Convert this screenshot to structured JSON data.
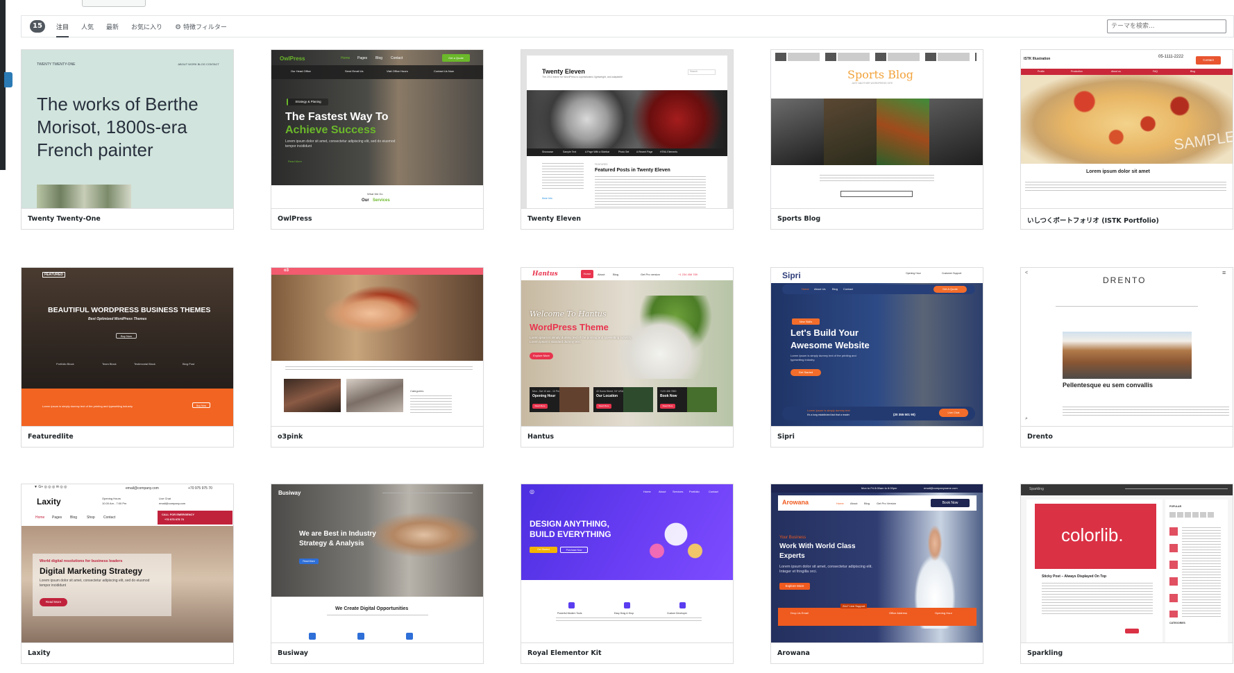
{
  "filter": {
    "count": "15",
    "tabs": [
      "注目",
      "人気",
      "最新",
      "お気に入り"
    ],
    "feature_filter": "特徴フィルター",
    "search_placeholder": "テーマを検索..."
  },
  "themes": [
    {
      "name": "Twenty Twenty-One",
      "preview": {
        "site": "TWENTY TWENTY-ONE",
        "menu": "ABOUT   WORK   BLOG   CONTACT",
        "headline": "The works of Berthe Morisot, 1800s-era French painter"
      }
    },
    {
      "name": "OwlPress",
      "preview": {
        "logo": "OwlPress",
        "nav": [
          "Home",
          "Pages",
          "Blog",
          "Contact"
        ],
        "quote": "Get a Quote",
        "info": [
          "Our Head Office",
          "Send Email Us",
          "Visit Office Hours",
          "Contact Us Now"
        ],
        "tag": "Strategy & Planing",
        "h1": "The Fastest Way To",
        "h2": "Achieve Success",
        "body": "Lorem ipsum dolor sit amet, consectetur adipiscing elit, sed do eiusmod tempor incididunt",
        "more": "Read More",
        "what": "What We Do",
        "our": "Our",
        "services": "Services"
      }
    },
    {
      "name": "Twenty Eleven",
      "preview": {
        "title": "Twenty Eleven",
        "subtitle": "The 2011 theme for WordPress is sophisticated, lightweight, and adaptable",
        "search": "Search",
        "nav": [
          "Showcase",
          "Sample Text",
          "A Page With a Sidebar",
          "Photo Set",
          "A Recent Page",
          "HTML Elements"
        ],
        "featured": "FEATURED",
        "posts_title": "Featured Posts in Twenty Eleven",
        "more": "More Info"
      }
    },
    {
      "name": "Sports Blog",
      "preview": {
        "logo": "Sports Blog",
        "tagline": "JUST ANOTHER WORDPRESS SITE"
      }
    },
    {
      "name": "いしつくボートフォリオ (ISTK Portfolio)",
      "preview": {
        "brand": "ISTK Illustration",
        "phone": "05-1111-2222",
        "contact": "Contact",
        "nav": [
          "Profile",
          "Production",
          "About us",
          "FAQ",
          "Blog"
        ],
        "watermark": "SAMPLE",
        "heading": "Lorem ipsum dolor sit amet"
      }
    },
    {
      "name": "Featuredlite",
      "preview": {
        "logo": "FEATURED",
        "h1": "BEAUTIFUL WORDPRESS BUSINESS THEMES",
        "h2": "Best Optimized WordPress Themes",
        "cta": "Buy Now",
        "items": [
          "Portfolio Block",
          "Team Block",
          "Testimonial Block",
          "Blog Post"
        ],
        "strip": "Lorem ipsum is simply dummy text of the printing and typesetting industry",
        "btn": "Buy Now"
      }
    },
    {
      "name": "o3pink",
      "preview": {
        "logo": "o3",
        "category": "Categories"
      }
    },
    {
      "name": "Hantus",
      "preview": {
        "logo": "Hantus",
        "nav": [
          "Home",
          "About",
          "Blog",
          "Get Pro version"
        ],
        "phone": "+1 234 456 789",
        "welcome": "Welcome To Hantus",
        "theme": "WordPress Theme",
        "body": "Lorem ipsum is simply dummy text of the printing and typesetting industry. Lorem Ipsum's standard dummy text.",
        "explore": "Explore More",
        "boxes": [
          {
            "small": "Mon - Sat 10 am - 10 Pm",
            "title": "Opening Hour"
          },
          {
            "small": "40 Sonia Street, NY USA",
            "title": "Our Location"
          },
          {
            "small": "+123 456 7890",
            "title": "Book Now"
          }
        ],
        "read": "Read More"
      }
    },
    {
      "name": "Sipri",
      "preview": {
        "logo": "Sipri",
        "hours_label": "Opening Hour",
        "support_label": "Customer Support",
        "nav": [
          "Home",
          "About Us",
          "Blog",
          "Contact"
        ],
        "quote": "Get A Quote",
        "badge": "New Skills",
        "h1": "Let's Build Your",
        "h2": "Awesome Website",
        "body": "Lorem Ipsum is simply dummy text of the printing and typesetting industry.",
        "started": "Get Started",
        "ribbon": "Lorem Ipsum is simply dummy text",
        "ribbon2": "It's a long established fact that a reader",
        "phone": "(20 355 501 90)",
        "live": "Live Chat"
      }
    },
    {
      "name": "Drento",
      "preview": {
        "logo": "DRENTO",
        "post": "Pellentesque eu sem convallis"
      }
    },
    {
      "name": "Laxity",
      "preview": {
        "email": "email@company.com",
        "phone": "+70 975 975 70",
        "logo": "Laxity",
        "hours": "Opening Hours",
        "hours_val": "10.00 Am - 7:00 Pm",
        "chat": "Live Chat",
        "chat_val": "email@company.com",
        "nav": [
          "Home",
          "Pages",
          "Blog",
          "Shop",
          "Contact"
        ],
        "emergency": "CALL FOR EMERGENCY",
        "emergency_num": "+70 975 975 70",
        "small": "World digital resolutions for business leaders",
        "h1": "Digital Marketing Strategy",
        "body": "Lorem ipsum dolor sit amet, consectetur adipiscing elit, sed do eiusmod tempor incididunt",
        "more": "Read More"
      }
    },
    {
      "name": "Busiway",
      "preview": {
        "logo": "Busiway",
        "h1": "We are Best in Industry",
        "h2": "Strategy & Analysis",
        "btn": "Read More",
        "bottom": "We Create Digital Opportunities"
      }
    },
    {
      "name": "Royal Elementor Kit",
      "preview": {
        "nav": [
          "Home",
          "About",
          "Services",
          "Portfolio",
          "Contact"
        ],
        "h1": "DESIGN ANYTHING,",
        "h2": "BUILD EVERYTHING",
        "btn1": "Get Started",
        "btn2": "Purchase Now",
        "features": [
          "Powerful Modern Tools",
          "Easy Drag & Drop",
          "Custom Developer"
        ]
      }
    },
    {
      "name": "Arowana",
      "preview": {
        "hours": "Mon to Fri 8:00am to 6:00pm",
        "email": "email@companyname.com",
        "logo": "Arowana",
        "nav": [
          "Home",
          "About",
          "Blog",
          "Get Pro Version"
        ],
        "book": "Book Now",
        "small": "Your Business",
        "h1": "Work With World Class",
        "h2": "Experts",
        "body": "Lorem ipsum dolor sit amet, consectetur adipiscing elit. Integer et fringilla orci.",
        "explore": "Explore More",
        "bar": [
          "Drop Us Email",
          "24x7 Live Support",
          "Office Address",
          "Opening Hour"
        ]
      }
    },
    {
      "name": "Sparkling",
      "preview": {
        "site": "Sparkling",
        "brand": "colorlib.",
        "post": "Sticky Post – Always Displayed On Top",
        "widget": "POPULAR",
        "categories": "CATEGORIES"
      }
    }
  ],
  "colors": {
    "owl_green": "#6bb82a",
    "hantus_red": "#e8344e",
    "sipri_orange": "#f26d2b",
    "laxity_red": "#c0223c",
    "royal_purple": "#5a3df0",
    "arowana_orange": "#ef5a1f",
    "sparkling_red": "#da3145"
  }
}
